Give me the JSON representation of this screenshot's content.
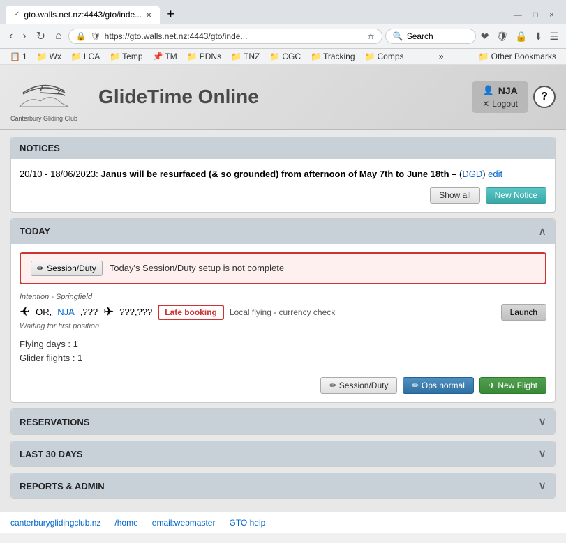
{
  "browser": {
    "tab": {
      "favicon": "✓",
      "title": "gto.walls.net.nz:4443/gto/inde...",
      "close": "×"
    },
    "new_tab": "+",
    "nav": {
      "back": "‹",
      "forward": "›",
      "reload": "↻",
      "home": "⌂"
    },
    "address": {
      "lock": "🔒",
      "url": "https://gto.walls.net.nz:4443/gto/inde...",
      "star": "☆"
    },
    "search": {
      "icon": "🔍",
      "placeholder": "Search"
    },
    "nav_icons": [
      "❤",
      "🛡",
      "🔒",
      "⬇",
      "☰"
    ],
    "bookmarks": [
      {
        "icon": "📋",
        "label": "1"
      },
      {
        "icon": "📁",
        "label": "Wx"
      },
      {
        "icon": "📁",
        "label": "LCA"
      },
      {
        "icon": "📁",
        "label": "Temp"
      },
      {
        "icon": "📌",
        "label": "TM"
      },
      {
        "icon": "📁",
        "label": "PDNs"
      },
      {
        "icon": "📁",
        "label": "TNZ"
      },
      {
        "icon": "📁",
        "label": "CGC"
      },
      {
        "icon": "📁",
        "label": "Tracking"
      },
      {
        "icon": "📁",
        "label": "Comps"
      }
    ],
    "bookmarks_more": "»",
    "other_bookmarks": "📁 Other Bookmarks"
  },
  "header": {
    "logo_club": "Canterbury Gliding Club",
    "title": "GlideTime Online",
    "username": "NJA",
    "logout_label": "Logout",
    "help_label": "?"
  },
  "notices": {
    "section_title": "NOTICES",
    "notice_date": "20/10 - 18/06/2023:",
    "notice_body": " Janus will be resurfaced (&amp; so grounded) from afternoon of May 7th to June 18th –",
    "notice_link_text": "DGD",
    "edit_label": "edit",
    "show_all_label": "Show all",
    "new_notice_label": "New Notice"
  },
  "today": {
    "section_title": "TODAY",
    "warning": {
      "session_duty_btn": "Session/Duty",
      "pencil_icon": "✏",
      "message": "Today's Session/Duty setup is not complete"
    },
    "intention": {
      "label": "Intention - Springfield",
      "glider1_icon": "✈",
      "or_text": "OR,",
      "nja_link": "NJA",
      "comma_qqq": ",???",
      "glider2_icon": "✈",
      "tow_text": "???,???",
      "late_booking": "Late booking",
      "local_flying": "Local flying - currency check",
      "launch_btn": "Launch",
      "waiting": "Waiting for first position"
    },
    "stats": {
      "flying_days_label": "Flying days :",
      "flying_days_value": "1",
      "glider_flights_label": "Glider flights :",
      "glider_flights_value": "1"
    },
    "actions": {
      "session_duty_label": "Session/Duty",
      "ops_normal_label": "Ops normal",
      "new_flight_label": "New Flight",
      "pencil1": "✏",
      "pencil2": "✏",
      "plane_icon": "✈"
    }
  },
  "reservations": {
    "section_title": "RESERVATIONS"
  },
  "last30days": {
    "section_title": "LAST 30 DAYS"
  },
  "reports": {
    "section_title": "REPORTS & ADMIN"
  },
  "footer": {
    "links": [
      {
        "label": "canterburyglidingclub.nz",
        "href": "#"
      },
      {
        "label": "/home",
        "href": "#"
      },
      {
        "label": "email:webmaster",
        "href": "#"
      },
      {
        "label": "GTO help",
        "href": "#"
      }
    ]
  }
}
